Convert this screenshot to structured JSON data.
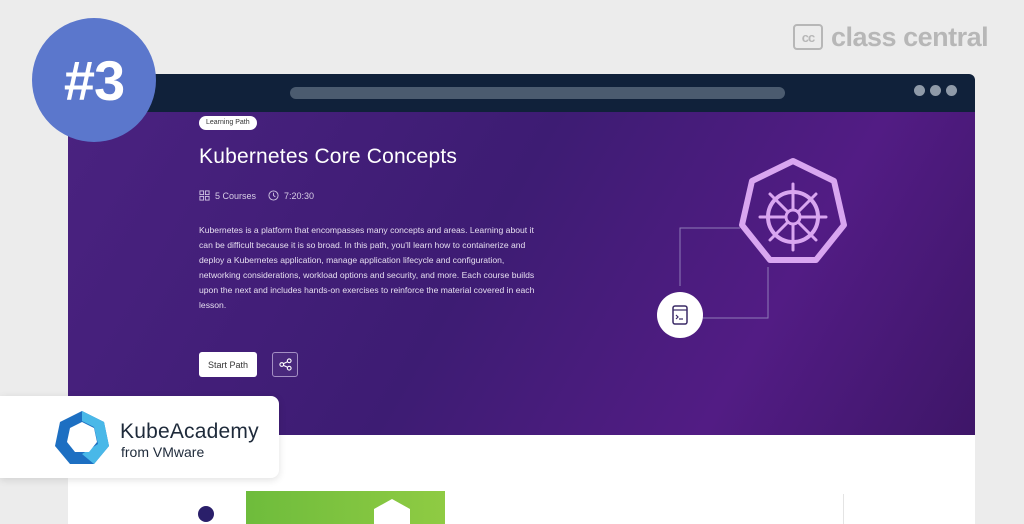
{
  "branding": {
    "site_logo_mark": "cc",
    "site_name": "class central",
    "rank": "#3"
  },
  "window": {
    "dot_color": "#8f9aa8",
    "topbar_color": "#10213a"
  },
  "hero": {
    "badge": "Learning Path",
    "title": "Kubernetes Core Concepts",
    "courses": "5 Courses",
    "duration": "7:20:30",
    "description": "Kubernetes is a platform that encompasses many concepts and areas. Learning about it can be difficult because it is so broad. In this path, you'll learn how to containerize and deploy a Kubernetes application, manage application lifecycle and configuration, networking considerations, workload options and security, and more. Each course builds upon the next and includes hands-on exercises to reinforce the material covered in each lesson.",
    "start_button": "Start Path",
    "share_icon": "share-icon",
    "accent": "#4a2280"
  },
  "provider": {
    "name": "KubeAcademy",
    "subtitle": "from VMware",
    "logo_colors": [
      "#1d6fc2",
      "#49b8e8"
    ]
  }
}
